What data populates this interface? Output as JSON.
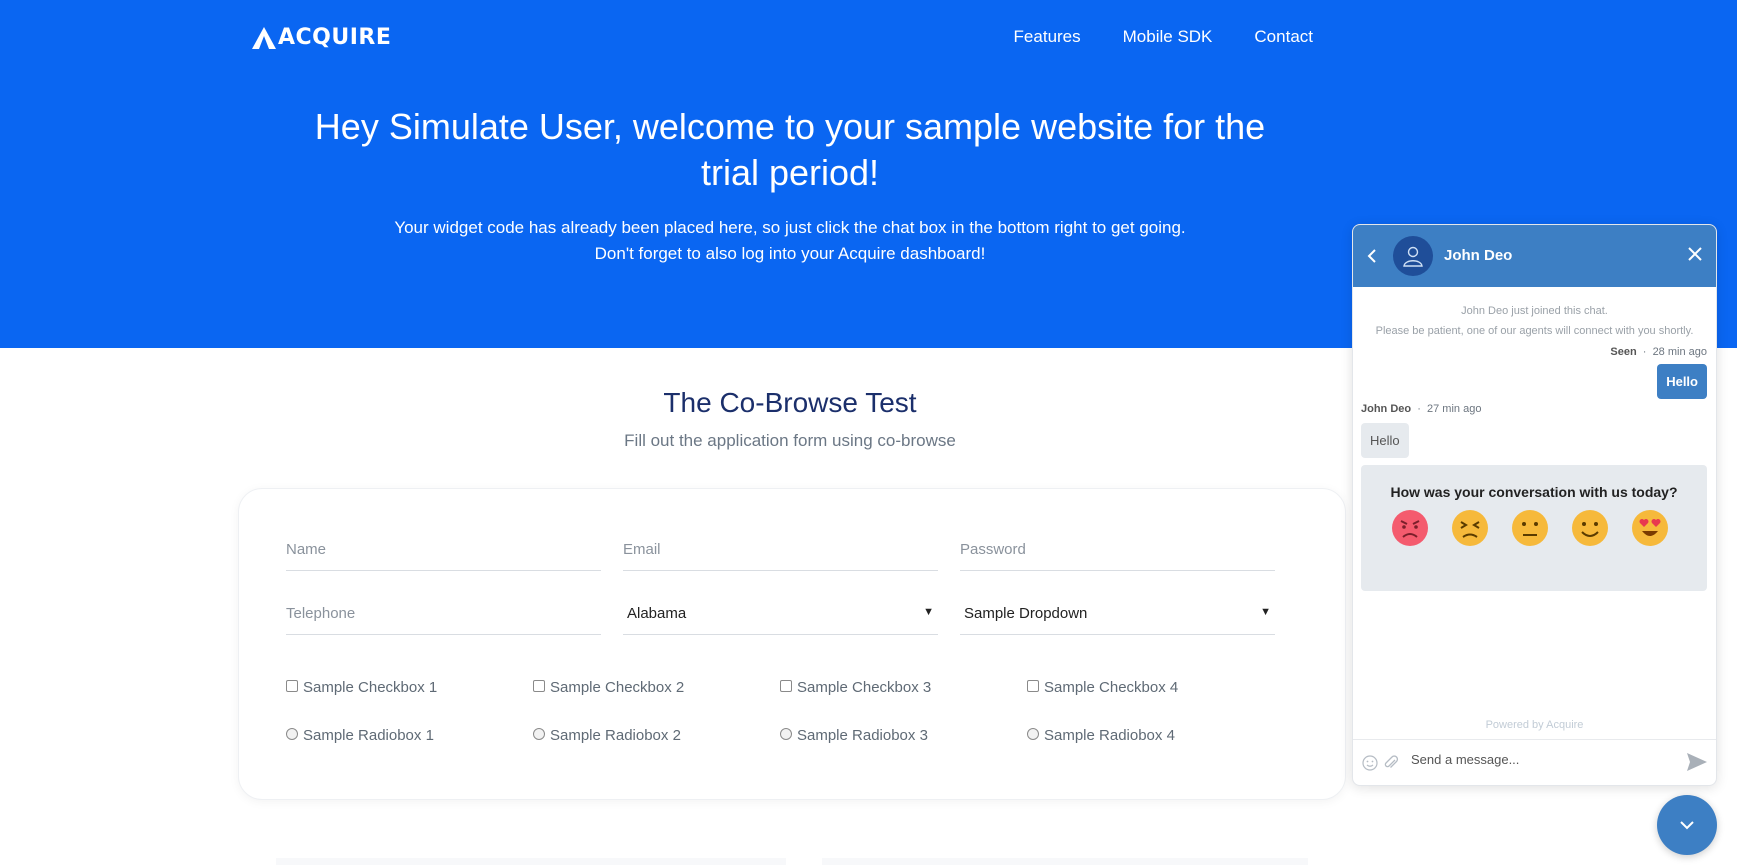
{
  "brand": {
    "name": "ACQUIRE"
  },
  "nav": {
    "items": [
      "Features",
      "Mobile SDK",
      "Contact"
    ]
  },
  "hero": {
    "title": "Hey Simulate User, welcome to your sample website for the trial period!",
    "subtitle_line1": "Your widget code has already been placed here, so just click the chat box in the bottom right to get going.",
    "subtitle_line2": "Don't forget to also log into your Acquire dashboard!"
  },
  "section": {
    "title": "The Co-Browse Test",
    "subtitle": "Fill out the application form using co-browse"
  },
  "form": {
    "name_placeholder": "Name",
    "email_placeholder": "Email",
    "password_placeholder": "Password",
    "telephone_placeholder": "Telephone",
    "state_value": "Alabama",
    "dropdown_value": "Sample Dropdown",
    "checkboxes": [
      "Sample Checkbox 1",
      "Sample Checkbox 2",
      "Sample Checkbox 3",
      "Sample Checkbox 4"
    ],
    "radios": [
      "Sample Radiobox 1",
      "Sample Radiobox 2",
      "Sample Radiobox 3",
      "Sample Radiobox 4"
    ]
  },
  "chat": {
    "agent_name": "John Deo",
    "joined_text": "John Deo just joined this chat.",
    "patience_text": "Please be patient, one of our agents will connect with you shortly.",
    "seen_label": "Seen",
    "seen_time": "28 min ago",
    "my_message": "Hello",
    "agent_meta_name": "John Deo",
    "agent_meta_time": "27 min ago",
    "agent_message": "Hello",
    "rating_question": "How was your conversation with us today?",
    "rating_options": [
      "angry-emoji",
      "frustrated-emoji",
      "neutral-emoji",
      "smile-emoji",
      "heart-eyes-emoji"
    ],
    "powered_by": "Powered by Acquire",
    "input_placeholder": "Send a message...",
    "accent_color": "#3d7fc4"
  },
  "colors": {
    "hero_bg": "#0a66f2",
    "section_title": "#1b2f6b"
  }
}
